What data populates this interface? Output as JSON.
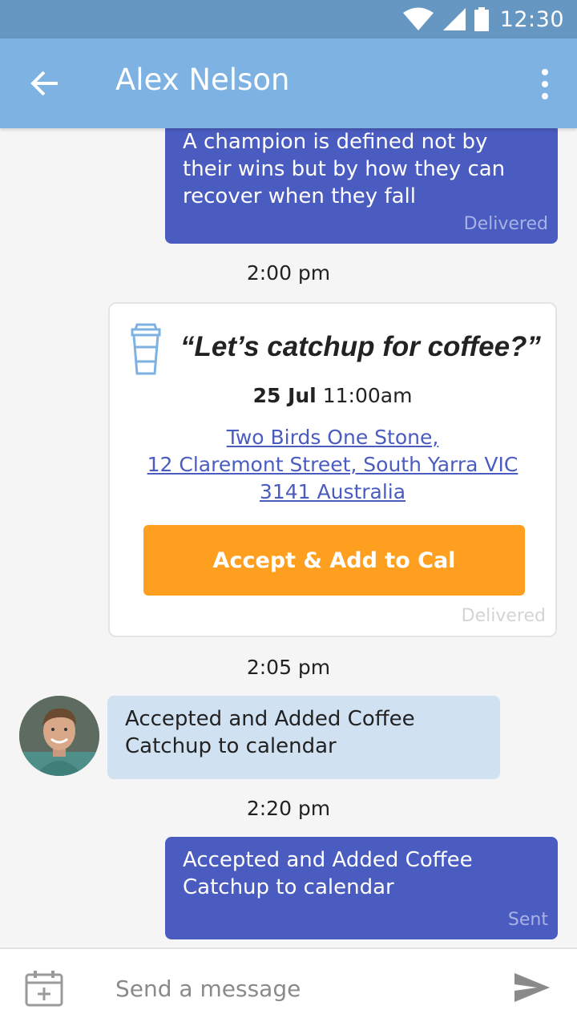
{
  "status_bar": {
    "time": "12:30"
  },
  "header": {
    "title": "Alex Nelson"
  },
  "messages": {
    "first_outgoing": {
      "text": "A champion is defined not by their wins but by how they can recover when they fall",
      "status": "Delivered"
    },
    "timestamp_1": "2:00 pm",
    "invite": {
      "title": "“Let’s catchup for coffee?”",
      "date": "25 Jul",
      "time": "11:00am",
      "address_line1": "Two Birds One Stone,",
      "address_line2": "12 Claremont Street, South Yarra VIC",
      "address_line3": "3141 Australia",
      "button_label": "Accept & Add to Cal",
      "status": "Delivered"
    },
    "timestamp_2": "2:05 pm",
    "incoming": {
      "text": "Accepted and Added Coffee Catchup to calendar"
    },
    "timestamp_3": "2:20 pm",
    "last_outgoing": {
      "text": "Accepted and Added Coffee Catchup to calendar",
      "status": "Sent"
    }
  },
  "composer": {
    "placeholder": "Send a message"
  },
  "colors": {
    "status_bar": "#6697c2",
    "app_bar": "#7eb2e3",
    "outgoing_bubble": "#4a5cbf",
    "incoming_bubble": "#d0e1f2",
    "accent_button": "#ff9f1f"
  },
  "icons": [
    "wifi-icon",
    "signal-icon",
    "battery-icon",
    "back-arrow-icon",
    "more-vert-icon",
    "coffee-cup-icon",
    "calendar-add-icon",
    "send-icon"
  ]
}
